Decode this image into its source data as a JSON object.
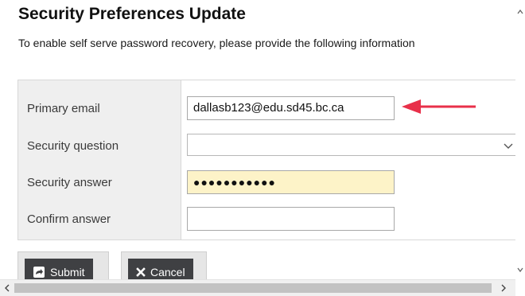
{
  "page": {
    "title": "Security Preferences Update",
    "intro": "To enable self serve password recovery, please provide the following information"
  },
  "form": {
    "fields": [
      {
        "label": "Primary email",
        "value": "dallasb123@edu.sd45.bc.ca"
      },
      {
        "label": "Security question",
        "value": ""
      },
      {
        "label": "Security answer",
        "value": "●●●●●●●●●●●"
      },
      {
        "label": "Confirm answer",
        "value": ""
      }
    ]
  },
  "buttons": {
    "submit": "Submit",
    "cancel": "Cancel"
  },
  "colors": {
    "arrow": "#e8304a",
    "answer_field_bg": "#fdf3c8",
    "button_bg": "#3f4043"
  },
  "icons": [
    "arrow-pointer-icon",
    "chevron-down-icon",
    "submit-icon",
    "close-icon",
    "scroll-left-icon",
    "scroll-right-icon",
    "scroll-up-icon",
    "scroll-down-icon"
  ]
}
